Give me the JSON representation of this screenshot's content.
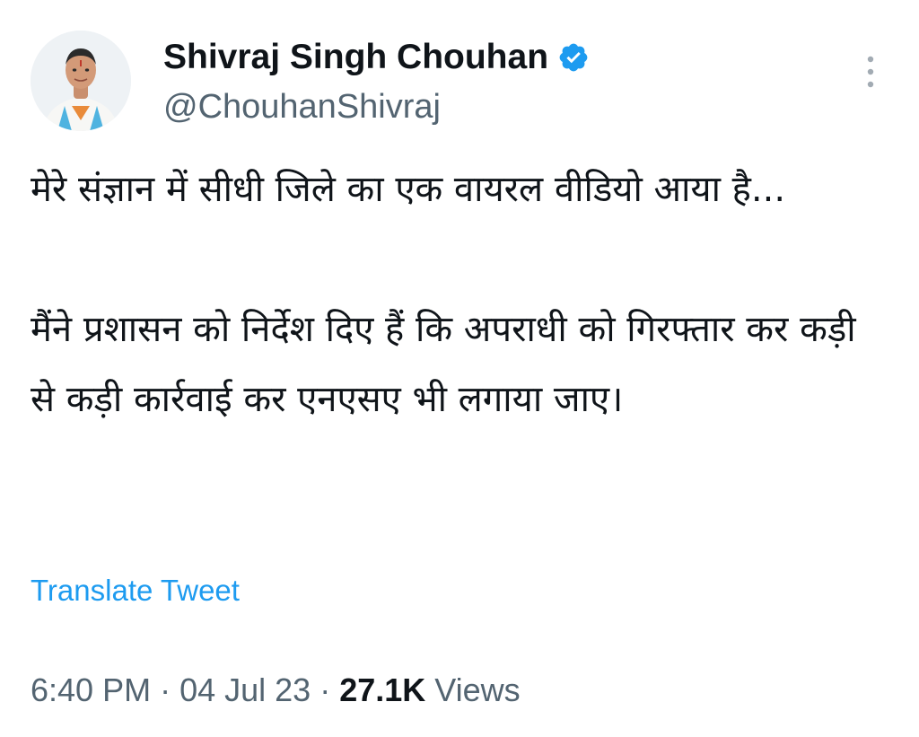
{
  "author": {
    "display_name": "Shivraj Singh Chouhan",
    "handle": "@ChouhanShivraj",
    "verified_icon": "verified-badge-icon",
    "verified_color": "#1d9bf0"
  },
  "tweet": {
    "paragraph_1": "मेरे संज्ञान में सीधी जिले का एक वायरल वीडियो आया है...",
    "paragraph_2": "मैंने प्रशासन को निर्देश दिए हैं कि अपराधी को गिरफ्तार कर कड़ी से कड़ी कार्रवाई कर एनएसए भी लगाया जाए।",
    "translate_label": "Translate Tweet"
  },
  "meta": {
    "time": "6:40 PM",
    "separator": " · ",
    "date": "04 Jul 23",
    "views_count": "27.1K",
    "views_label": " Views"
  },
  "colors": {
    "link": "#1d9bf0",
    "secondary_text": "#536471",
    "primary_text": "#0f1419"
  }
}
